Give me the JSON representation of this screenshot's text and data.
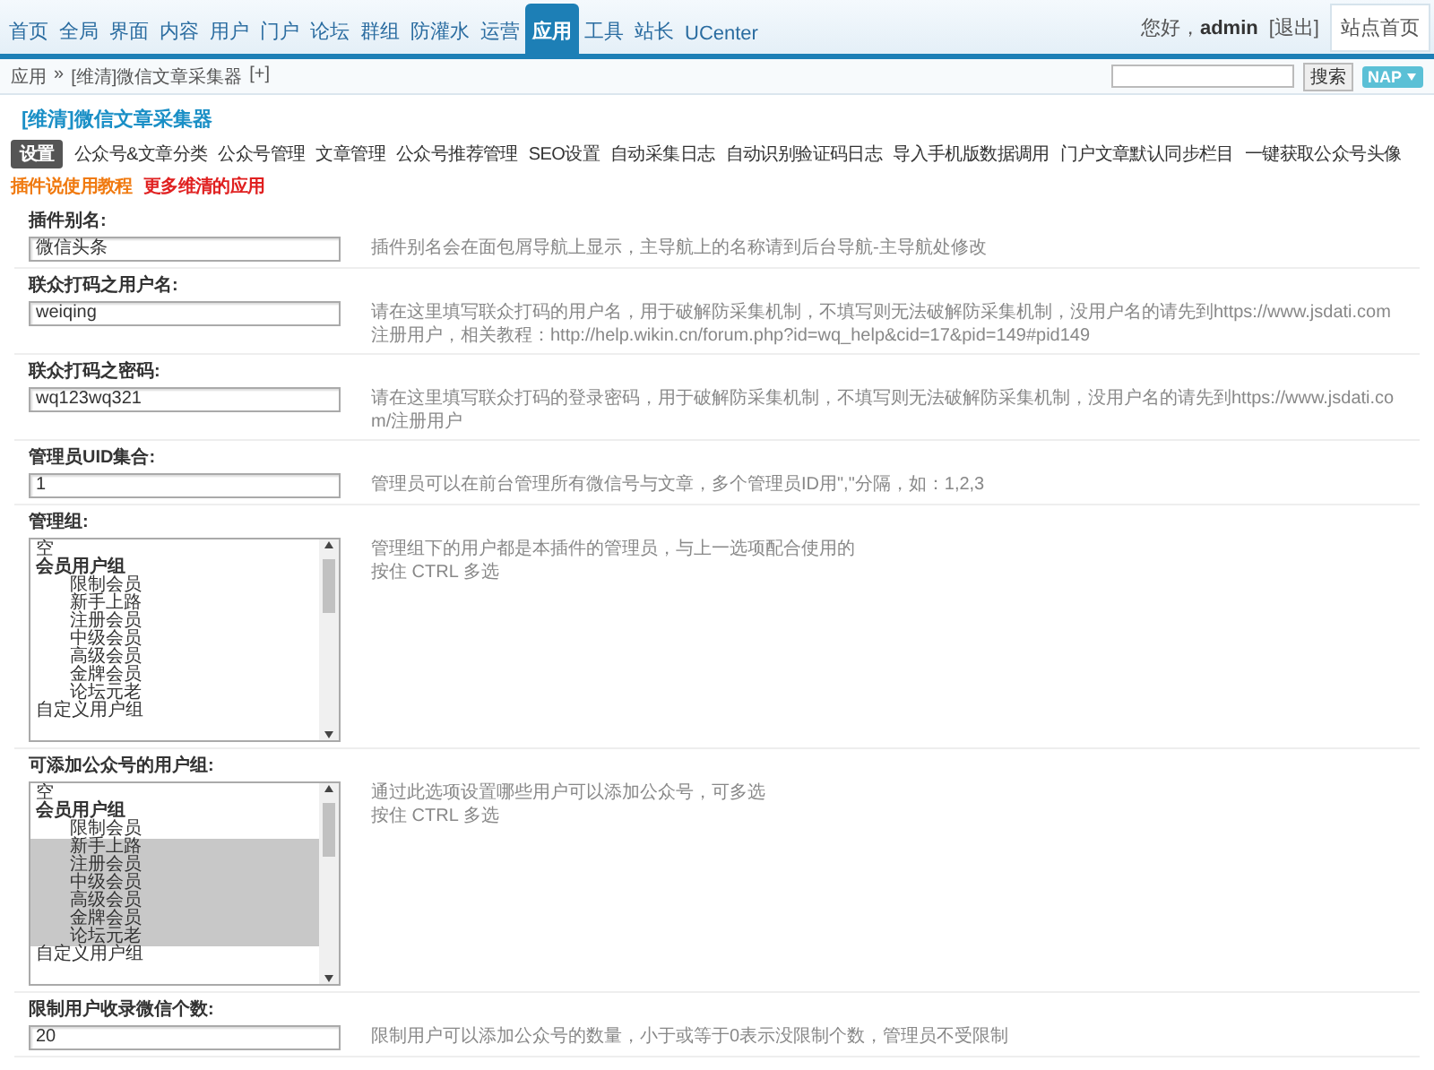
{
  "top_nav": {
    "items": [
      {
        "label": "首页",
        "selected": false
      },
      {
        "label": "全局",
        "selected": false
      },
      {
        "label": "界面",
        "selected": false
      },
      {
        "label": "内容",
        "selected": false
      },
      {
        "label": "用户",
        "selected": false
      },
      {
        "label": "门户",
        "selected": false
      },
      {
        "label": "论坛",
        "selected": false
      },
      {
        "label": "群组",
        "selected": false
      },
      {
        "label": "防灌水",
        "selected": false
      },
      {
        "label": "运营",
        "selected": false
      },
      {
        "label": "应用",
        "selected": true
      },
      {
        "label": "工具",
        "selected": false
      },
      {
        "label": "站长",
        "selected": false
      },
      {
        "label": "UCenter",
        "selected": false
      }
    ],
    "greeting": "您好，",
    "user": "admin",
    "logout": "[退出]",
    "site_home": "站点首页"
  },
  "breadcrumb": {
    "items": [
      "应用",
      "[维清]微信文章采集器"
    ],
    "separator": "»",
    "add": "[+]",
    "search_button": "搜索",
    "map_button": "NAP"
  },
  "plugin": {
    "title": "[维清]微信文章采集器",
    "tabs": [
      {
        "label": "设置",
        "selected": true,
        "kind": "normal"
      },
      {
        "label": "公众号&文章分类",
        "selected": false,
        "kind": "normal"
      },
      {
        "label": "公众号管理",
        "selected": false,
        "kind": "normal"
      },
      {
        "label": "文章管理",
        "selected": false,
        "kind": "normal"
      },
      {
        "label": "公众号推荐管理",
        "selected": false,
        "kind": "normal"
      },
      {
        "label": "SEO设置",
        "selected": false,
        "kind": "normal"
      },
      {
        "label": "自动采集日志",
        "selected": false,
        "kind": "normal"
      },
      {
        "label": "自动识别验证码日志",
        "selected": false,
        "kind": "normal"
      },
      {
        "label": "导入手机版数据调用",
        "selected": false,
        "kind": "normal"
      },
      {
        "label": "门户文章默认同步栏目",
        "selected": false,
        "kind": "normal"
      },
      {
        "label": "一键获取公众号头像",
        "selected": false,
        "kind": "normal"
      },
      {
        "label": "插件说使用教程",
        "selected": false,
        "kind": "tutorial"
      },
      {
        "label": "更多维清的应用",
        "selected": false,
        "kind": "more"
      }
    ]
  },
  "settings": [
    {
      "kind": "text",
      "label": "插件别名:",
      "value": "微信头条",
      "hints": [
        "插件别名会在面包屑导航上显示，主导航上的名称请到后台导航-主导航处修改"
      ]
    },
    {
      "kind": "text",
      "label": "联众打码之用户名:",
      "value": "weiqing",
      "hints": [
        "请在这里填写联众打码的用户名，用于破解防采集机制，不填写则无法破解防采集机制，没用户名的请先到https://www.jsdati.com注册用户，相关教程：http://help.wikin.cn/forum.php?id=wq_help&cid=17&pid=149#pid149"
      ]
    },
    {
      "kind": "text",
      "label": "联众打码之密码:",
      "value": "wq123wq321",
      "hints": [
        "请在这里填写联众打码的登录密码，用于破解防采集机制，不填写则无法破解防采集机制，没用户名的请先到https://www.jsdati.com/注册用户"
      ]
    },
    {
      "kind": "text",
      "label": "管理员UID集合:",
      "value": "1",
      "hints": [
        "管理员可以在前台管理所有微信号与文章，多个管理员ID用\",\"分隔，如：1,2,3"
      ]
    },
    {
      "kind": "select",
      "label": "管理组:",
      "hints": [
        "管理组下的用户都是本插件的管理员，与上一选项配合使用的",
        "按住 CTRL 多选"
      ],
      "options": [
        {
          "label": "空",
          "selected": false
        },
        {
          "label": "会员用户组",
          "selected": false,
          "children": [
            {
              "label": "限制会员",
              "selected": false
            },
            {
              "label": "新手上路",
              "selected": false
            },
            {
              "label": "注册会员",
              "selected": false
            },
            {
              "label": "中级会员",
              "selected": false
            },
            {
              "label": "高级会员",
              "selected": false
            },
            {
              "label": "金牌会员",
              "selected": false
            },
            {
              "label": "论坛元老",
              "selected": false
            }
          ]
        },
        {
          "label": "自定义用户组",
          "selected": false
        }
      ]
    },
    {
      "kind": "select",
      "label": "可添加公众号的用户组:",
      "hints": [
        "通过此选项设置哪些用户可以添加公众号，可多选",
        "按住 CTRL 多选"
      ],
      "options": [
        {
          "label": "空",
          "selected": false
        },
        {
          "label": "会员用户组",
          "selected": false,
          "children": [
            {
              "label": "限制会员",
              "selected": false
            },
            {
              "label": "新手上路",
              "selected": true
            },
            {
              "label": "注册会员",
              "selected": true
            },
            {
              "label": "中级会员",
              "selected": true
            },
            {
              "label": "高级会员",
              "selected": true
            },
            {
              "label": "金牌会员",
              "selected": true
            },
            {
              "label": "论坛元老",
              "selected": true
            }
          ]
        },
        {
          "label": "自定义用户组",
          "selected": false
        }
      ]
    },
    {
      "kind": "text",
      "label": "限制用户收录微信个数:",
      "value": "20",
      "hints": [
        "限制用户可以添加公众号的数量，小于或等于0表示没限制个数，管理员不受限制"
      ]
    }
  ]
}
